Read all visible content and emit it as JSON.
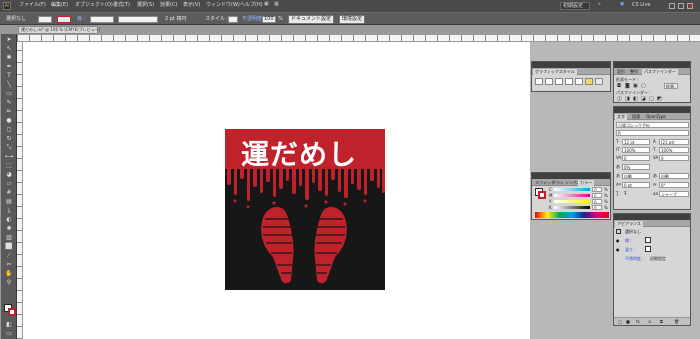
{
  "app": {
    "logo": "Ai",
    "menus": [
      "ファイル(F)",
      "編集(E)",
      "オブジェクト(O)",
      "書式(T)",
      "選択(S)",
      "効果(C)",
      "表示(V)",
      "ウィンドウ(W)",
      "ヘルプ(H)"
    ],
    "workspace": "初期設定",
    "cs_live": "CS Live"
  },
  "control": {
    "selection_label": "選択なし",
    "stroke_label": "線 :",
    "stroke_weight": "2 pt 楕円",
    "style_label": "スタイル :",
    "opacity_label": "不透明度 :",
    "opacity_value": "100",
    "opacity_unit": "%",
    "doc_setup_button": "ドキュメント設定",
    "prefs_button": "環境設定"
  },
  "document": {
    "tab_title": "運だめし.ai* @ 106 % (CMYK/プレビュー)"
  },
  "artwork": {
    "title": "運だめし",
    "colors": {
      "red": "#c0222c",
      "black": "#171717",
      "white": "#ffffff"
    }
  },
  "panels": {
    "graphic_styles": {
      "tab": "グラフィックスタイル"
    },
    "pathfinder": {
      "tabs": [
        "変形",
        "整列",
        "パスファインダー"
      ],
      "shape_modes_label": "形状モード :",
      "pathfinder_label": "パスファインダー :",
      "expand_button": "拡張"
    },
    "character": {
      "tabs": [
        "文字",
        "段落",
        "OpenType"
      ],
      "font_family": "小塚ゴシック Pro",
      "font_style": "R",
      "font_size": "12 pt",
      "leading": "(21 pt)",
      "vertical_scale": "100%",
      "horizontal_scale": "100%",
      "kerning": "0",
      "tracking": "0",
      "tsume": "0%",
      "aki_left": "自動",
      "aki_right": "自動",
      "baseline": "0 pt",
      "rotation": "0°",
      "antialias": "シャープ"
    },
    "color": {
      "tabs": [
        "スウォッチ",
        "ブラシ",
        "シンボル",
        "カラー"
      ],
      "channels": [
        "C",
        "M",
        "Y",
        "K"
      ],
      "values": [
        "0",
        "0",
        "0",
        "0"
      ],
      "unit": "%"
    },
    "appearance": {
      "tab": "アピアランス",
      "header": "選択なし",
      "stroke_label": "線 :",
      "fill_label": "塗り :",
      "opacity_label": "不透明度 :",
      "opacity_value": "初期設定"
    }
  },
  "icons": [
    "selection-icon",
    "direct-selection-icon",
    "pen-icon",
    "type-icon",
    "line-icon",
    "rectangle-icon",
    "brush-icon",
    "pencil-icon",
    "rotate-icon",
    "scale-icon",
    "width-icon",
    "eyedropper-icon",
    "gradient-icon",
    "mesh-icon",
    "blend-icon",
    "symbol-sprayer-icon",
    "graph-icon",
    "artboard-icon",
    "slice-icon",
    "eraser-icon",
    "scissors-icon",
    "hand-icon",
    "zoom-icon"
  ]
}
